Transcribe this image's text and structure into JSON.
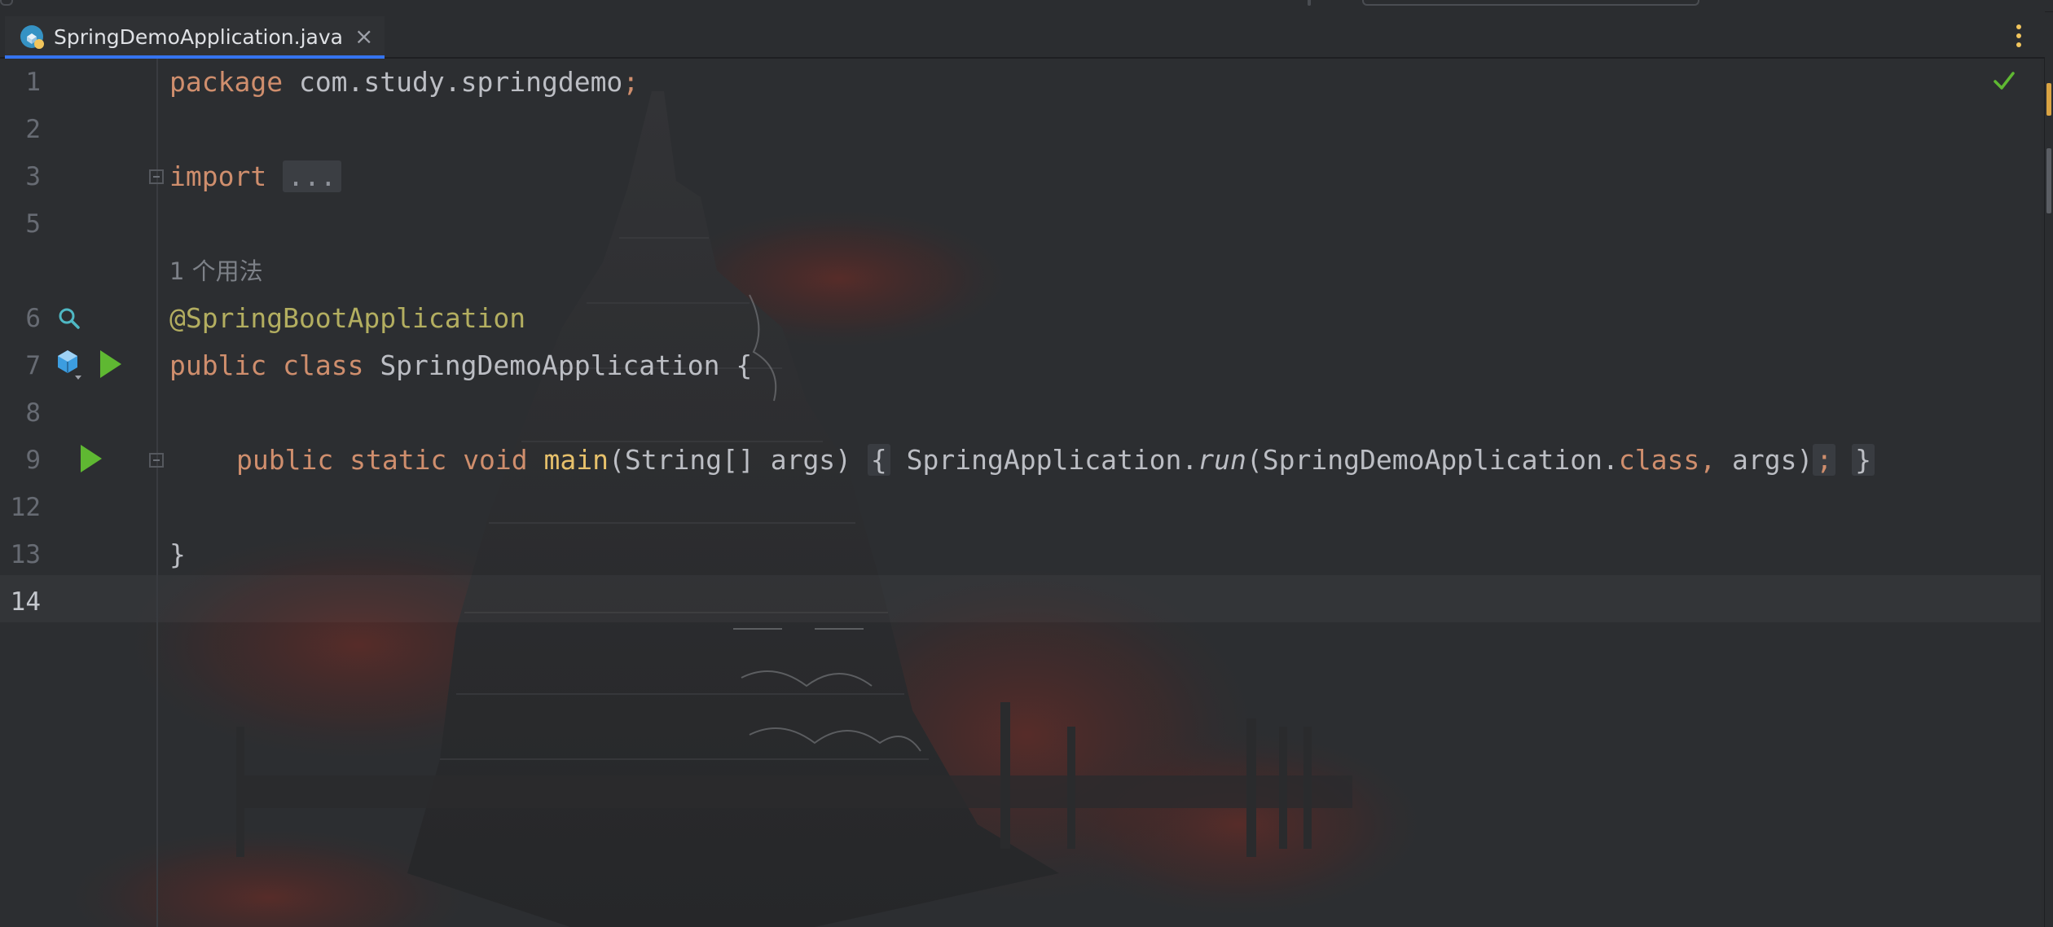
{
  "tab": {
    "filename": "SpringDemoApplication.java",
    "close_glyph": "×"
  },
  "gutter": {
    "line_numbers": [
      "1",
      "2",
      "3",
      "5",
      "6",
      "7",
      "8",
      "9",
      "12",
      "13",
      "14"
    ]
  },
  "code": {
    "l1": {
      "kw": "package",
      "pkg": " com.study.springdemo",
      "semi": ";"
    },
    "l3": {
      "kw": "import",
      "fold": "..."
    },
    "usage_hint": "1 个用法",
    "l6": {
      "ann": "@SpringBootApplication"
    },
    "l7": {
      "kw1": "public",
      "kw2": "class",
      "cls": "SpringDemoApplication",
      "brace": "{"
    },
    "l9": {
      "kw1": "public",
      "kw2": "static",
      "kw3": "void",
      "name": "main",
      "params": "(String[] args)",
      "brace_open": "{",
      "callee": "SpringApplication.",
      "method": "run",
      "arg1": "(SpringDemoApplication.",
      "kw_class": "class",
      "comma": ", ",
      "arg2": "args)",
      "semi": ";",
      "brace_close": "}"
    },
    "l13": {
      "brace": "}"
    }
  },
  "colors": {
    "keyword": "#cf8e6d",
    "annotation": "#b3ae60",
    "method": "#e7c16b",
    "text": "#bcbec4",
    "accent": "#3574f0",
    "run_icon": "#5fb832",
    "check": "#5fb832"
  },
  "icons": [
    "java-class-icon",
    "close-icon",
    "more-vertical-icon",
    "inspection-ok-icon",
    "bean-search-icon",
    "spring-bean-icon",
    "run-icon",
    "fold-icon"
  ]
}
